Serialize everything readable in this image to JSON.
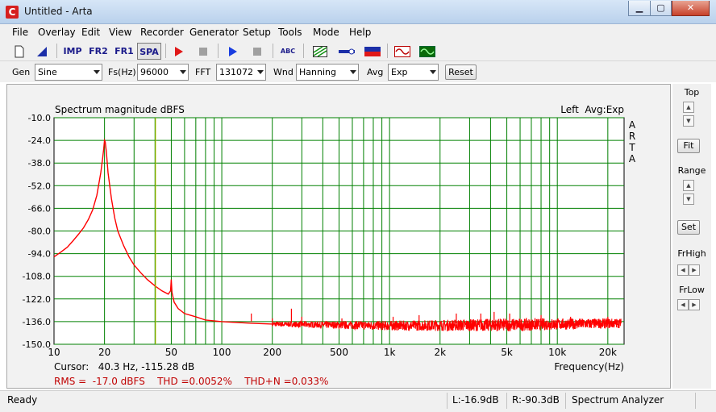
{
  "window": {
    "title": "Untitled - Arta",
    "minimize_glyph": "▁",
    "maximize_glyph": "▢",
    "close_glyph": "✕",
    "icon": "C"
  },
  "menu": [
    "File",
    "Overlay",
    "Edit",
    "View",
    "Recorder",
    "Generator",
    "Setup",
    "Tools",
    "Mode",
    "Help"
  ],
  "toolbar": {
    "imp_label": "IMP",
    "fr2_label": "FR2",
    "fr1_label": "FR1",
    "spa_label": "SPA",
    "abc_label": "ABC"
  },
  "controls": {
    "gen_label": "Gen",
    "gen_value": "Sine",
    "fs_label": "Fs(Hz)",
    "fs_value": "96000",
    "fft_label": "FFT",
    "fft_value": "131072",
    "wnd_label": "Wnd",
    "wnd_value": "Hanning",
    "avg_label": "Avg",
    "avg_value": "Exp",
    "reset_label": "Reset"
  },
  "side": {
    "top_label": "Top",
    "fit_label": "Fit",
    "range_label": "Range",
    "set_label": "Set",
    "frhigh_label": "FrHigh",
    "frlow_label": "FrLow"
  },
  "status": {
    "ready": "Ready",
    "left_level": "L:-16.9dB",
    "right_level": "R:-90.3dB",
    "mode": "Spectrum Analyzer"
  },
  "chart_data": {
    "type": "line",
    "title": "Spectrum magnitude dBFS",
    "top_right_label": "Left  Avg:Exp",
    "side_text": [
      "A",
      "R",
      "T",
      "A"
    ],
    "xlabel": "Frequency(Hz)",
    "x_scale": "log",
    "xlim": [
      10,
      25000
    ],
    "ylim": [
      -150,
      -10
    ],
    "x_tick_values": [
      10,
      20,
      50,
      100,
      200,
      500,
      1000,
      2000,
      5000,
      10000,
      20000
    ],
    "x_tick_labels": [
      "10",
      "20",
      "50",
      "100",
      "200",
      "500",
      "1k",
      "2k",
      "5k",
      "10k",
      "20k"
    ],
    "y_tick_values": [
      -10,
      -24,
      -38,
      -52,
      -66,
      -80,
      -94,
      -108,
      -122,
      -136,
      -150
    ],
    "y_tick_labels": [
      "-10.0",
      "-24.0",
      "-38.0",
      "-52.0",
      "-66.0",
      "-80.0",
      "-94.0",
      "-108.0",
      "-122.0",
      "-136.0",
      "-150.0"
    ],
    "grid": true,
    "colors": {
      "background": "#ffffff",
      "grid": "#008000",
      "trace": "#ff0000",
      "cursor": "#c8c800",
      "text": "#000000",
      "summary_text": "#c00000"
    },
    "cursor": {
      "x": 40.3,
      "y": -115.28,
      "label": "Cursor:   40.3 Hz, -115.28 dB"
    },
    "summary": "RMS =  -17.0 dBFS    THD =0.0052%    THD+N =0.033%",
    "series": [
      {
        "color": "#ff0000",
        "x": [
          10,
          11,
          12,
          13,
          14,
          15,
          16,
          17,
          18,
          19,
          19.5,
          19.8,
          20,
          20.2,
          20.5,
          21,
          22,
          23,
          24,
          26,
          28,
          30,
          33,
          36,
          40,
          44,
          48,
          49.5,
          50,
          50.5,
          52,
          55,
          60,
          70,
          80,
          100,
          150,
          200
        ],
        "y": [
          -96,
          -93,
          -90,
          -86,
          -82,
          -78,
          -73,
          -67,
          -58,
          -44,
          -35,
          -29,
          -24,
          -25,
          -31,
          -44,
          -60,
          -72,
          -80,
          -89,
          -96,
          -101,
          -106,
          -110,
          -114,
          -117,
          -119,
          -117,
          -110,
          -118,
          -124,
          -128,
          -131,
          -133,
          -135,
          -136,
          -137,
          -137.5
        ]
      }
    ],
    "noise_floor": {
      "x_start": 200,
      "x_end": 24000,
      "base_db": [
        -137.5,
        -138.5,
        -138,
        -137
      ],
      "base_freqs": [
        200,
        1000,
        5000,
        24000
      ],
      "spread_db": [
        1.5,
        3,
        4,
        3
      ]
    },
    "spurs": [
      {
        "x": 150,
        "y": -131
      },
      {
        "x": 200,
        "y": -134
      },
      {
        "x": 260,
        "y": -128
      },
      {
        "x": 300,
        "y": -133
      },
      {
        "x": 520,
        "y": -134
      },
      {
        "x": 1050,
        "y": -133
      },
      {
        "x": 1500,
        "y": -132
      },
      {
        "x": 2500,
        "y": -131
      },
      {
        "x": 3500,
        "y": -131
      },
      {
        "x": 4200,
        "y": -130
      },
      {
        "x": 5200,
        "y": -131
      },
      {
        "x": 8000,
        "y": -132
      },
      {
        "x": 12000,
        "y": -133
      },
      {
        "x": 20000,
        "y": -133
      }
    ]
  }
}
